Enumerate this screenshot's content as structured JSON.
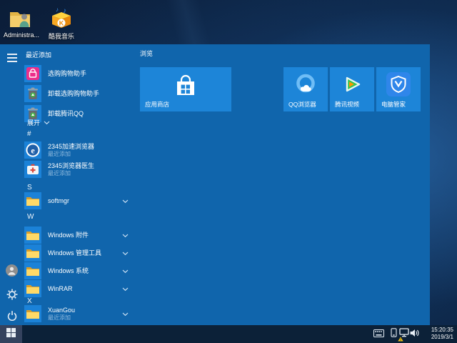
{
  "desktop": {
    "icons": [
      {
        "label": "Administra...",
        "icon": "user-folder-icon"
      },
      {
        "label": "酷我音乐",
        "icon": "kuwo-music-icon"
      }
    ]
  },
  "start_menu": {
    "recent_header": "最近添加",
    "recent_items": [
      {
        "label": "选购购物助手"
      },
      {
        "label": "卸载选购购物助手"
      },
      {
        "label": "卸载腾讯QQ"
      }
    ],
    "expand_label": "展开",
    "sections": {
      "hash": {
        "letter": "#",
        "items": [
          {
            "label": "2345加速浏览器",
            "sub": "最近添加"
          },
          {
            "label": "2345浏览器医生",
            "sub": "最近添加"
          }
        ]
      },
      "s": {
        "letter": "S",
        "items": [
          {
            "label": "softmgr"
          }
        ]
      },
      "w": {
        "letter": "W",
        "items": [
          {
            "label": "Windows 附件"
          },
          {
            "label": "Windows 管理工具"
          },
          {
            "label": "Windows 系统"
          },
          {
            "label": "WinRAR"
          }
        ]
      },
      "x": {
        "letter": "X",
        "items": [
          {
            "label": "XuanGou",
            "sub": "最近添加"
          }
        ]
      }
    },
    "tiles": {
      "group_label": "浏览",
      "store": {
        "label": "应用商店"
      },
      "qq_browser": {
        "label": "QQ浏览器"
      },
      "tencent_video": {
        "label": "腾讯视频"
      },
      "pc_manager": {
        "label": "电脑管家"
      }
    }
  },
  "taskbar": {
    "time": "15:20:35",
    "date": "2019/3/1"
  },
  "colors": {
    "menu_bg": "#1065AC",
    "tile_blue": "#1D85D8",
    "plate_blue": "#1B82D8",
    "taskbar_bg": "#0C2138",
    "warning_yellow": "#F5C518"
  }
}
